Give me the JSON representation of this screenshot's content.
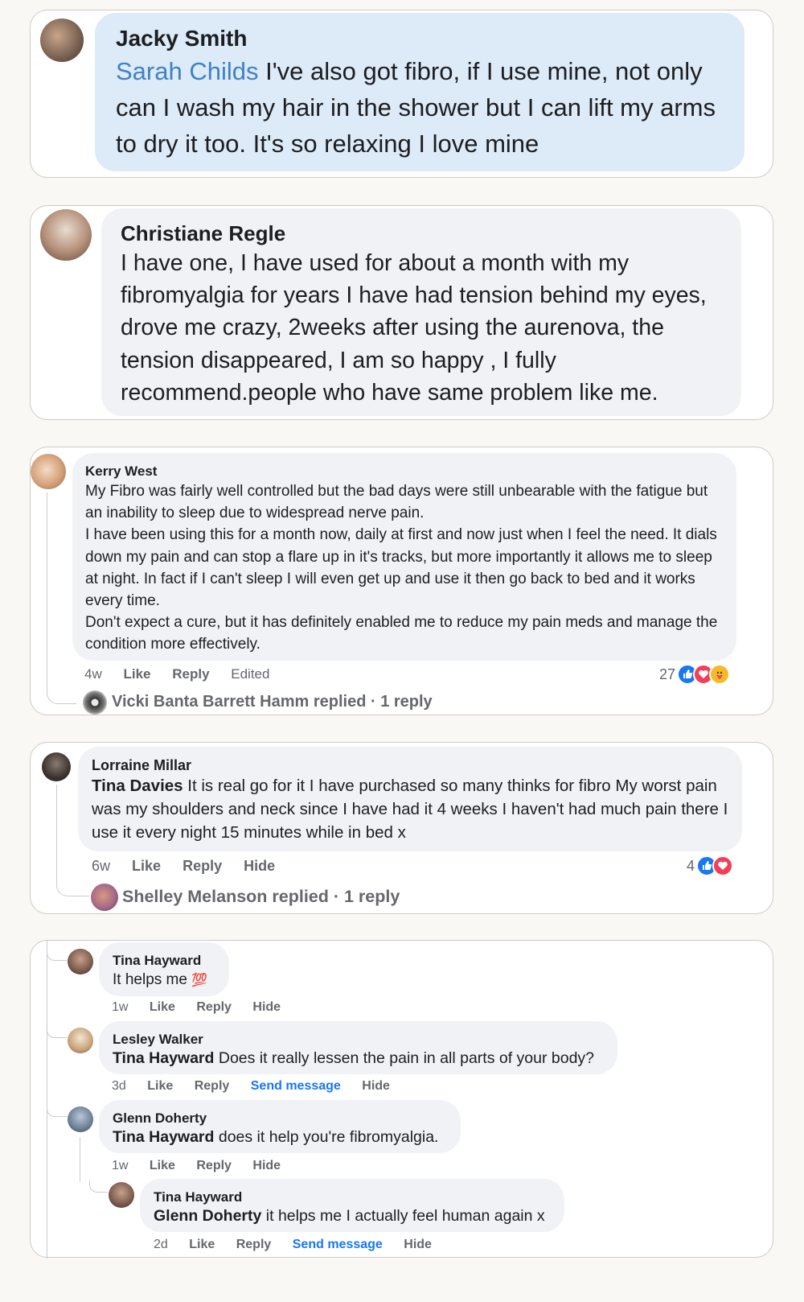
{
  "comments": [
    {
      "author": "Jacky Smith",
      "mention": "Sarah Childs",
      "text": " I've also got fibro, if I use mine, not only can I wash my hair in the shower but I can lift my arms to dry it too. It's so relaxing I love mine"
    },
    {
      "author": "Christiane Regle",
      "text": "I have one, I have used for about a month with my fibromyalgia for years I have had tension behind my eyes, drove me crazy, 2weeks after using the aurenova, the tension disappeared, I am so happy , I fully recommend.people who have same problem like me."
    },
    {
      "author": "Kerry West",
      "paragraphs": [
        "My Fibro was fairly well controlled but the bad days were still unbearable with the fatigue but an inability to sleep due to widespread nerve pain.",
        "I have been using this for a month now, daily at first and now just when I feel the need. It dials down my pain and can stop a flare up in it's tracks, but more importantly it allows me to sleep at night. In fact if I can't sleep I will even get up and use it then go back to bed and it works every time.",
        "Don't expect a cure, but it has definitely enabled me to reduce my pain meds and manage the condition more effectively."
      ],
      "time": "4w",
      "like": "Like",
      "reply": "Reply",
      "edited": "Edited",
      "reaction_count": "27",
      "replied_text": "Vicki Banta Barrett Hamm replied · 1 reply"
    },
    {
      "author": "Lorraine Millar",
      "mention": "Tina Davies",
      "text": " It is real go for it I have purchased so many thinks for fibro My worst pain was my shoulders and neck since I have had it 4 weeks I haven't had much pain there I use it every night 15 minutes while in bed x",
      "time": "6w",
      "like": "Like",
      "reply": "Reply",
      "hide": "Hide",
      "reaction_count": "4",
      "replied_text": "Shelley Melanson replied · 1 reply"
    }
  ],
  "thread": [
    {
      "author": "Tina Hayward",
      "text": "It helps me",
      "emoji": "💯",
      "time": "1w",
      "like": "Like",
      "reply": "Reply",
      "hide": "Hide"
    },
    {
      "author": "Lesley Walker",
      "mention": "Tina Hayward",
      "text": " Does it really lessen the pain in all parts of your body?",
      "time": "3d",
      "like": "Like",
      "reply": "Reply",
      "send": "Send message",
      "hide": "Hide"
    },
    {
      "author": "Glenn Doherty",
      "mention": "Tina Hayward",
      "text": " does it help you're fibromyalgia.",
      "time": "1w",
      "like": "Like",
      "reply": "Reply",
      "hide": "Hide"
    },
    {
      "author": "Tina Hayward",
      "mention": "Glenn Doherty",
      "text": " it helps me I actually feel human again x",
      "time": "2d",
      "like": "Like",
      "reply": "Reply",
      "send": "Send message",
      "hide": "Hide"
    }
  ],
  "colors": {
    "bubble_highlight": "#ddeaf8",
    "bubble": "#f0f2f5",
    "mention_link": "#3f82c4",
    "send_message_link": "#1877f2"
  },
  "icons": {
    "reactions_kerry": [
      "like-icon",
      "love-icon",
      "care-icon"
    ],
    "reactions_lorraine": [
      "like-icon",
      "love-icon"
    ]
  }
}
